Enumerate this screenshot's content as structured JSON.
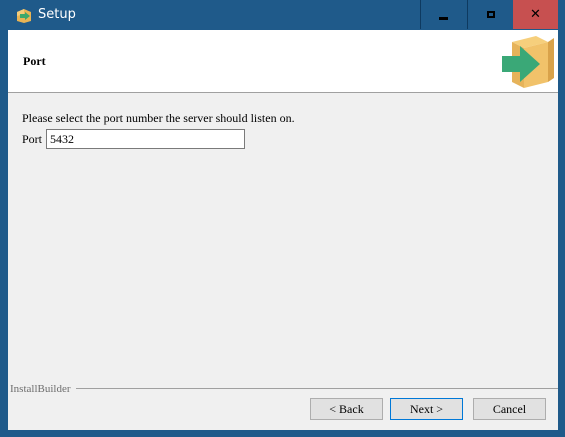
{
  "window": {
    "title": "Setup",
    "controls": {
      "minimize": "minimize-icon",
      "maximize": "maximize-icon",
      "close": "close-icon"
    }
  },
  "header": {
    "title": "Port",
    "logo": "installer-box-arrow-icon"
  },
  "body": {
    "instructions": "Please select the port number the server should listen on.",
    "port_label": "Port",
    "port_value": "5432"
  },
  "footer": {
    "brand": "InstallBuilder",
    "back_label": "< Back",
    "next_label": "Next >",
    "cancel_label": "Cancel"
  },
  "colors": {
    "titlebar": "#1f5a8a",
    "close_hover": "#c75050",
    "accent": "#0078d7"
  }
}
